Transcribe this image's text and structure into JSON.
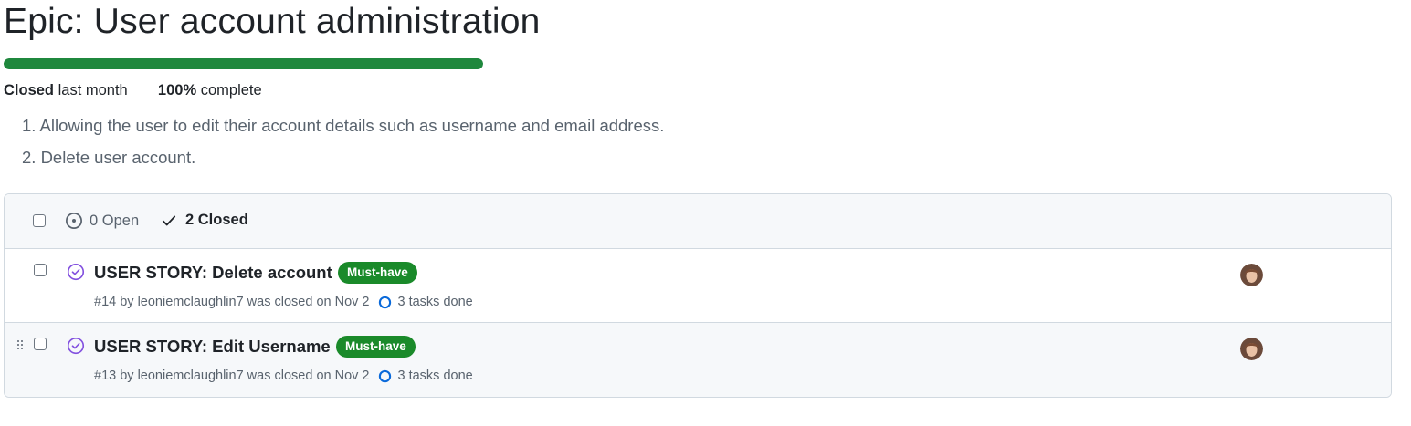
{
  "epic": {
    "title": "Epic: User account administration",
    "progress_fraction": 1.0,
    "progress_color": "#1f883d",
    "status_word": "Closed",
    "status_when": "last month",
    "percent_value": "100%",
    "percent_suffix": "complete",
    "description": [
      "1. Allowing the user to edit their account details such as username and email address.",
      "2. Delete user account."
    ]
  },
  "issues_panel": {
    "open_label": "0 Open",
    "closed_label": "2 Closed",
    "rows": [
      {
        "title": "USER STORY: Delete account",
        "label": "Must-have",
        "label_color": "#1a8a2a",
        "number": "#14",
        "by_text": "by leoniemclaughlin7 was closed on Nov 2",
        "tasks": "3 tasks done",
        "state_icon": "closed-completed-icon",
        "avatar_icon": "user-avatar"
      },
      {
        "title": "USER STORY: Edit Username",
        "label": "Must-have",
        "label_color": "#1a8a2a",
        "number": "#13",
        "by_text": "by leoniemclaughlin7 was closed on Nov 2",
        "tasks": "3 tasks done",
        "state_icon": "closed-completed-icon",
        "avatar_icon": "user-avatar"
      }
    ]
  },
  "colors": {
    "closed_purple": "#8250df",
    "tasks_blue": "#0969da"
  }
}
